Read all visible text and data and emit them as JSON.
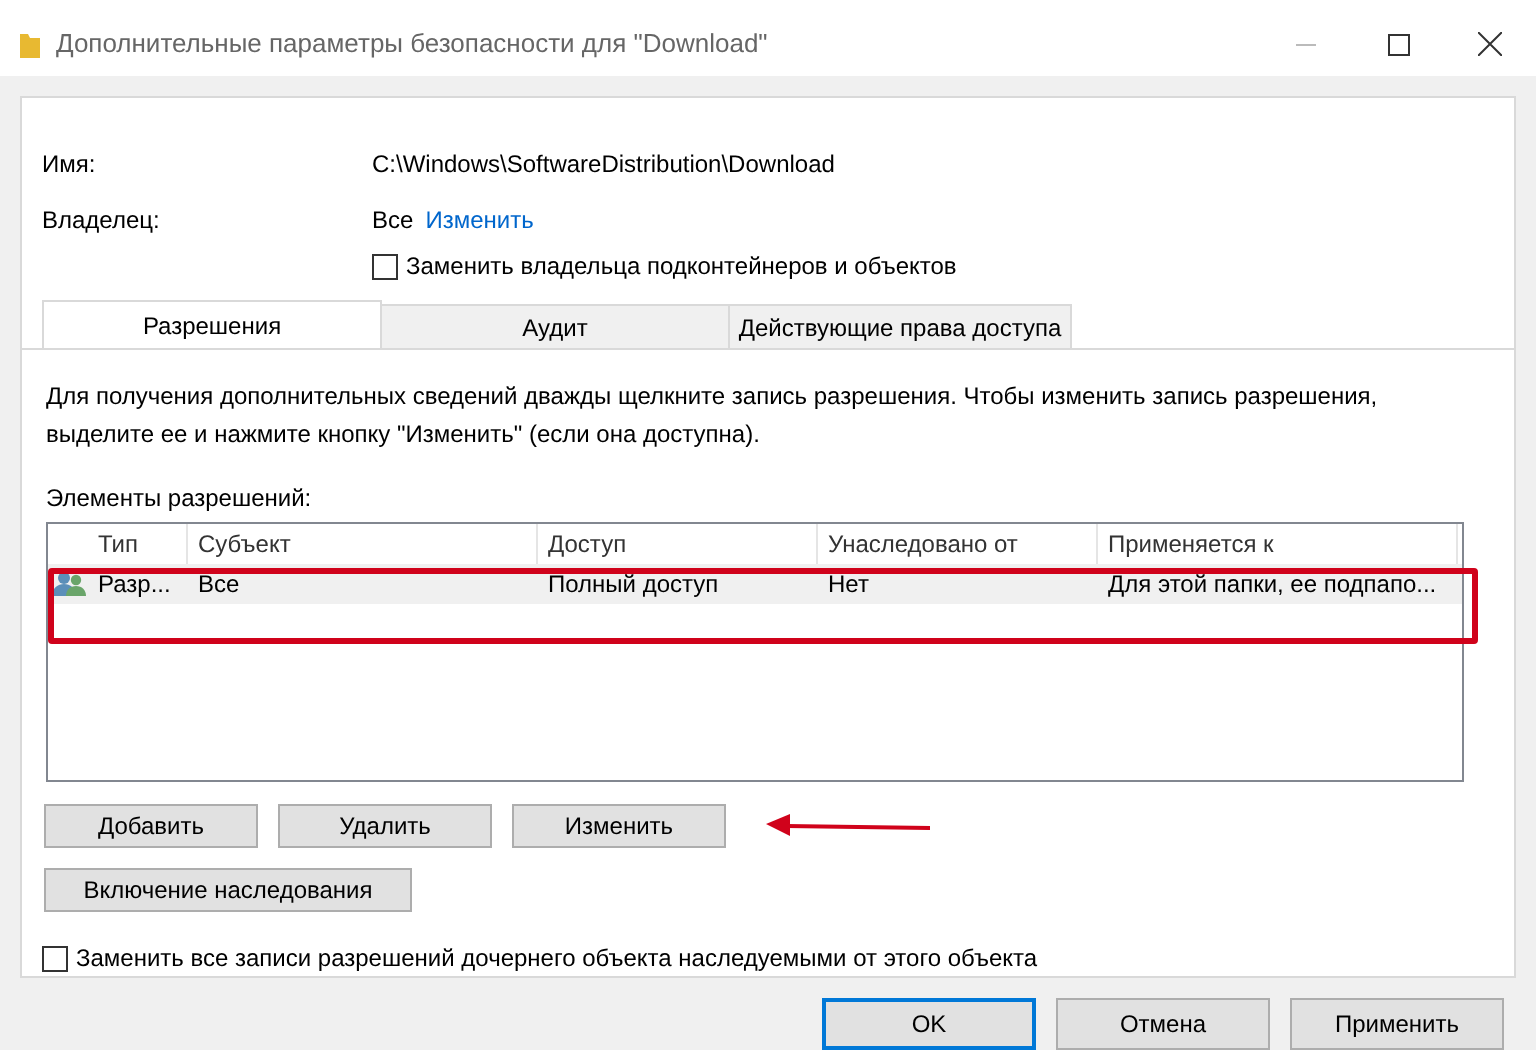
{
  "window": {
    "title": "Дополнительные параметры безопасности  для \"Download\""
  },
  "name_label": "Имя:",
  "name_value": "C:\\Windows\\SoftwareDistribution\\Download",
  "owner_label": "Владелец:",
  "owner_value": "Все",
  "owner_link": "Изменить",
  "replace_owner": {
    "label": "Заменить владельца подконтейнеров и объектов",
    "checked": false
  },
  "tabs": [
    {
      "label": "Разрешения",
      "selected": true
    },
    {
      "label": "Аудит",
      "selected": false
    },
    {
      "label": "Действующие права доступа",
      "selected": false
    }
  ],
  "info_text": "Для получения дополнительных сведений дважды щелкните запись разрешения. Чтобы изменить запись разрешения, выделите ее и нажмите кнопку \"Изменить\" (если она доступна).",
  "list_label": "Элементы разрешений:",
  "table": {
    "columns": [
      "Тип",
      "Субъект",
      "Доступ",
      "Унаследовано от",
      "Применяется к"
    ],
    "rows": [
      {
        "cells": [
          "Разр...",
          "Все",
          "Полный доступ",
          "Нет",
          "Для этой папки, ее подпапо..."
        ],
        "selected": true,
        "highlighted": true
      }
    ]
  },
  "buttons": [
    "Добавить",
    "Удалить",
    "Изменить"
  ],
  "inherit_button": "Включение наследования",
  "replace_children": {
    "label": "Заменить все записи разрешений дочернего объекта наследуемыми от этого объекта",
    "checked": false
  },
  "footer_buttons": [
    {
      "label": "OK",
      "default": true
    },
    {
      "label": "Отмена",
      "default": false
    },
    {
      "label": "Применить",
      "default": false
    }
  ]
}
